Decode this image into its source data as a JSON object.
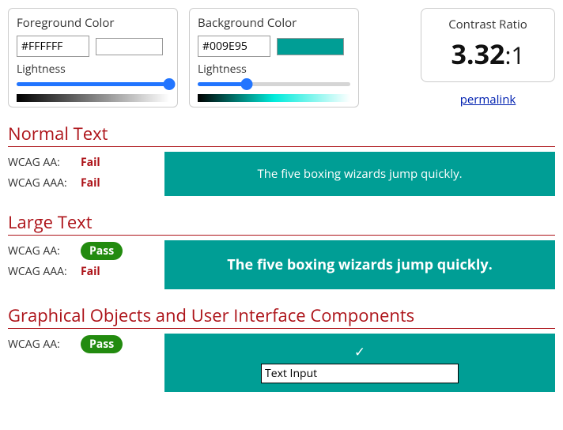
{
  "foreground": {
    "title": "Foreground Color",
    "hex": "#FFFFFF",
    "lightness_label": "Lightness",
    "lightness_pct": 100,
    "gradient_css": "linear-gradient(to right, #000, #fff)"
  },
  "background": {
    "title": "Background Color",
    "hex": "#009E95",
    "lightness_label": "Lightness",
    "lightness_pct": 32,
    "gradient_css": "linear-gradient(to right, #000, #00ebdb, #fff)"
  },
  "ratio": {
    "label": "Contrast Ratio",
    "value": "3.32",
    "suffix": ":1",
    "permalink": "permalink"
  },
  "sections": {
    "normal": {
      "title": "Normal Text",
      "aa_label": "WCAG AA:",
      "aa_result": "Fail",
      "aa_pass": false,
      "aaa_label": "WCAG AAA:",
      "aaa_result": "Fail",
      "aaa_pass": false,
      "sample": "The five boxing wizards jump quickly."
    },
    "large": {
      "title": "Large Text",
      "aa_label": "WCAG AA:",
      "aa_result": "Pass",
      "aa_pass": true,
      "aaa_label": "WCAG AAA:",
      "aaa_result": "Fail",
      "aaa_pass": false,
      "sample": "The five boxing wizards jump quickly."
    },
    "ui": {
      "title": "Graphical Objects and User Interface Components",
      "aa_label": "WCAG AA:",
      "aa_result": "Pass",
      "aa_pass": true,
      "checkmark": "✓",
      "input_value": "Text Input"
    }
  }
}
